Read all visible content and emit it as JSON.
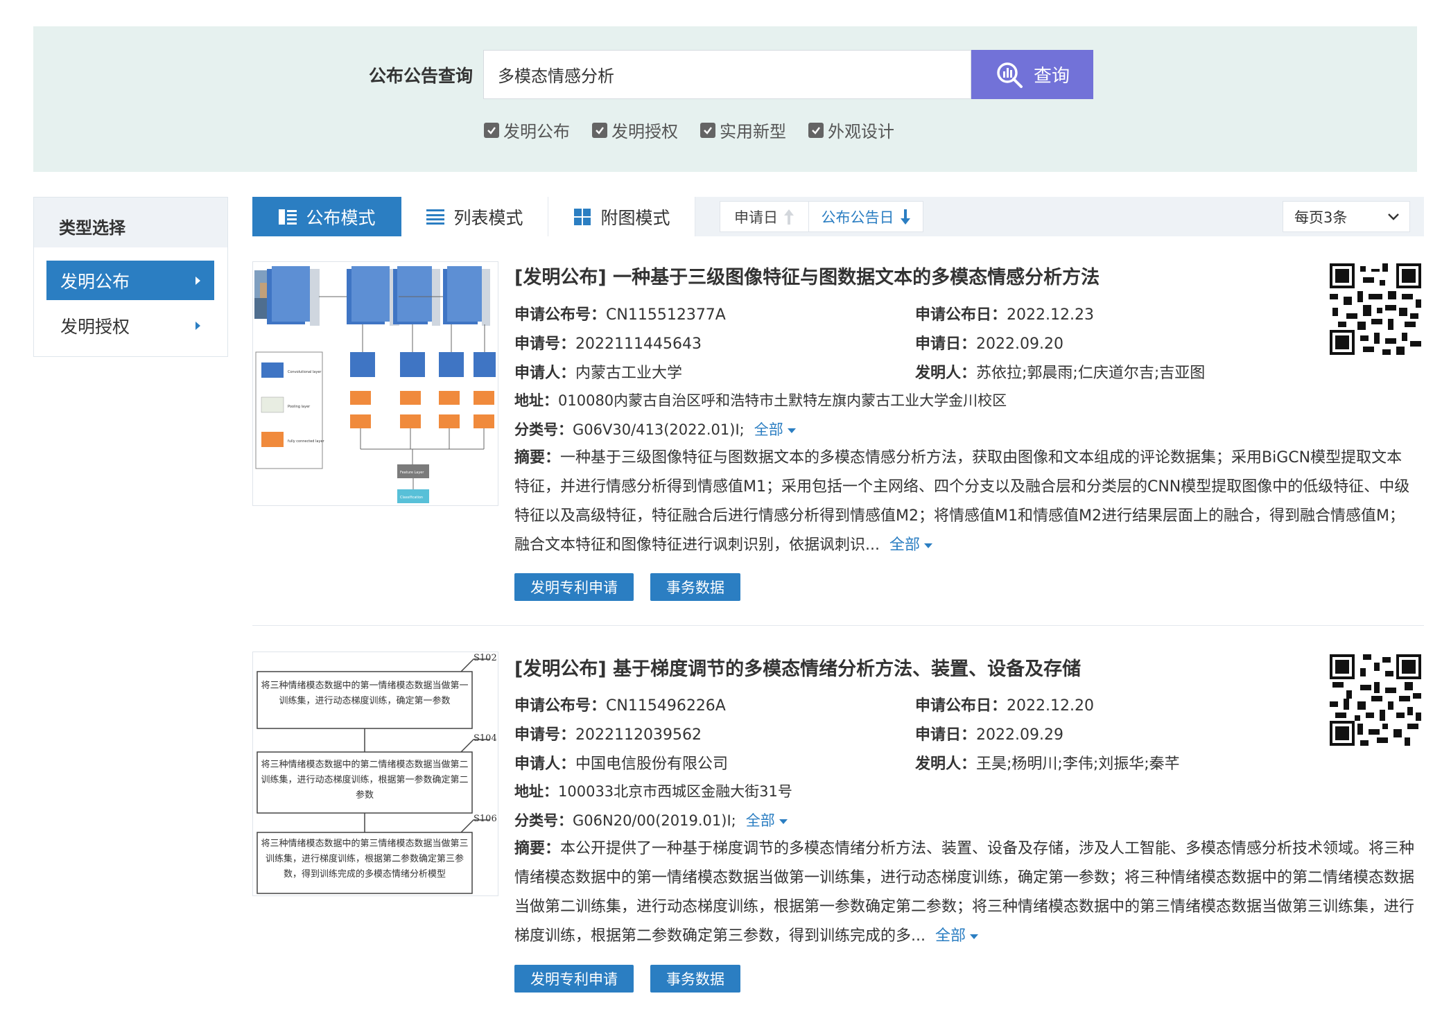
{
  "search": {
    "label": "公布公告查询",
    "value": "多模态情感分析",
    "button_label": "查询",
    "filters": [
      {
        "label": "发明公布",
        "checked": true
      },
      {
        "label": "发明授权",
        "checked": true
      },
      {
        "label": "实用新型",
        "checked": true
      },
      {
        "label": "外观设计",
        "checked": true
      }
    ]
  },
  "sidebar": {
    "title": "类型选择",
    "items": [
      {
        "label": "发明公布",
        "active": true
      },
      {
        "label": "发明授权",
        "active": false
      }
    ]
  },
  "toolbar": {
    "modes": [
      {
        "label": "公布模式",
        "active": true
      },
      {
        "label": "列表模式",
        "active": false
      },
      {
        "label": "附图模式",
        "active": false
      }
    ],
    "sort_apply_date": "申请日",
    "sort_pub_date": "公布公告日",
    "per_page": "每页3条"
  },
  "results": [
    {
      "title": "[发明公布] 一种基于三级图像特征与图数据文本的多模态情感分析方法",
      "pub_no_label": "申请公布号：",
      "pub_no": "CN115512377A",
      "pub_date_label": "申请公布日：",
      "pub_date": "2022.12.23",
      "app_no_label": "申请号：",
      "app_no": "2022111445643",
      "app_date_label": "申请日：",
      "app_date": "2022.09.20",
      "applicant_label": "申请人：",
      "applicant": "内蒙古工业大学",
      "inventor_label": "发明人：",
      "inventor": "苏依拉;郭晨雨;仁庆道尔吉;吉亚图",
      "address_label": "地址：",
      "address": "010080内蒙古自治区呼和浩特市土默特左旗内蒙古工业大学金川校区",
      "class_label": "分类号：",
      "class": "G06V30/413(2022.01)I;",
      "all_label": "全部",
      "abstract_label": "摘要：",
      "abstract": "一种基于三级图像特征与图数据文本的多模态情感分析方法，获取由图像和文本组成的评论数据集；采用BiGCN模型提取文本特征，并进行情感分析得到情感值M1；采用包括一个主网络、四个分支以及融合层和分类层的CNN模型提取图像中的低级特征、中级特征以及高级特征，特征融合后进行情感分析得到情感值M2；将情感值M1和情感值M2进行结果层面上的融合，得到融合情感值M；融合文本特征和图像特征进行讽刺识别，依据讽刺识...",
      "figure_labels": [
        "Convolutional layer",
        "Pooling layer",
        "fully connected layer",
        "Feature Layer",
        "Classification"
      ],
      "btn_apply": "发明专利申请",
      "btn_affairs": "事务数据"
    },
    {
      "title": "[发明公布] 基于梯度调节的多模态情绪分析方法、装置、设备及存储",
      "pub_no_label": "申请公布号：",
      "pub_no": "CN115496226A",
      "pub_date_label": "申请公布日：",
      "pub_date": "2022.12.20",
      "app_no_label": "申请号：",
      "app_no": "2022112039562",
      "app_date_label": "申请日：",
      "app_date": "2022.09.29",
      "applicant_label": "申请人：",
      "applicant": "中国电信股份有限公司",
      "inventor_label": "发明人：",
      "inventor": "王昊;杨明川;李伟;刘振华;秦芊",
      "address_label": "地址：",
      "address": "100033北京市西城区金融大街31号",
      "class_label": "分类号：",
      "class": "G06N20/00(2019.01)I;",
      "all_label": "全部",
      "abstract_label": "摘要：",
      "abstract": "本公开提供了一种基于梯度调节的多模态情绪分析方法、装置、设备及存储，涉及人工智能、多模态情感分析技术领域。将三种情绪模态数据中的第一情绪模态数据当做第一训练集，进行动态梯度训练，确定第一参数；将三种情绪模态数据中的第二情绪模态数据当做第二训练集，进行动态梯度训练，根据第一参数确定第二参数；将三种情绪模态数据中的第三情绪模态数据当做第三训练集，进行梯度训练，根据第二参数确定第三参数，得到训练完成的多...",
      "flow_steps": [
        {
          "tag": "S102",
          "text": "将三种情绪模态数据中的第一情绪模态数据当做第一训练集，进行动态梯度训练，确定第一参数"
        },
        {
          "tag": "S104",
          "text": "将三种情绪模态数据中的第二情绪模态数据当做第二训练集，进行动态梯度训练，根据第一参数确定第二参数"
        },
        {
          "tag": "S106",
          "text": "将三种情绪模态数据中的第三情绪模态数据当做第三训练集，进行梯度训练，根据第二参数确定第三参数，得到训练完成的多模态情绪分析模型"
        }
      ],
      "btn_apply": "发明专利申请",
      "btn_affairs": "事务数据"
    }
  ],
  "colors": {
    "accent": "#2b7ec2",
    "search_button": "#7272d8",
    "panel_bg": "#e6f1ef"
  },
  "icons": [
    "search-chart-icon",
    "checkbox-icon",
    "publish-mode-icon",
    "list-mode-icon",
    "grid-mode-icon",
    "arrow-up-icon",
    "arrow-down-icon",
    "chevron-down-icon",
    "qr-code-icon"
  ]
}
